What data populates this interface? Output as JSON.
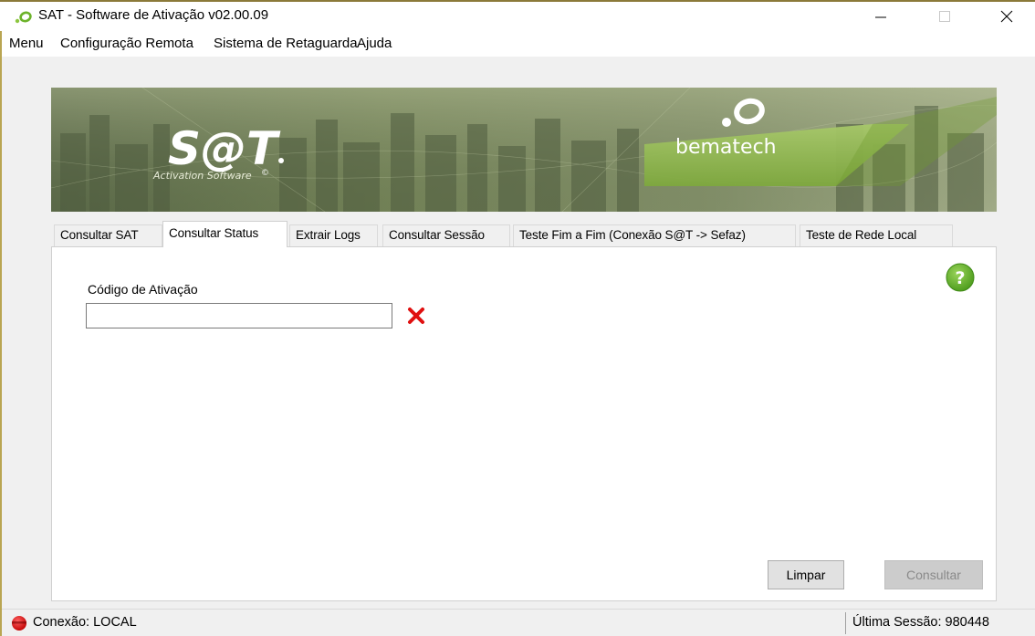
{
  "window": {
    "title": "SAT - Software de Ativação v02.00.09"
  },
  "menu": {
    "items": [
      "Menu",
      "Configuração Remota",
      "Sistema de Retaguarda",
      "Ajuda"
    ]
  },
  "banner": {
    "product_logo": "S@T",
    "product_tagline": "Activation Software",
    "brand_logo": "bematech"
  },
  "tabs": [
    {
      "label": "Consultar SAT",
      "active": false
    },
    {
      "label": "Consultar Status",
      "active": true
    },
    {
      "label": "Extrair Logs",
      "active": false
    },
    {
      "label": "Consultar Sessão",
      "active": false
    },
    {
      "label": "Teste Fim a Fim (Conexão S@T -> Sefaz)",
      "active": false
    },
    {
      "label": "Teste de Rede Local",
      "active": false
    }
  ],
  "form": {
    "activation_code_label": "Código de Ativação",
    "activation_code_value": "",
    "activation_code_placeholder": "",
    "error_icon": "red-x-icon",
    "help_icon": "help-icon"
  },
  "buttons": {
    "clear": "Limpar",
    "submit": "Consultar"
  },
  "statusbar": {
    "connection": "Conexão: LOCAL",
    "last_session": "Última Sessão: 980448"
  },
  "colors": {
    "brand_green": "#6db32b",
    "error_red": "#e01010",
    "help_green": "#5aa820"
  }
}
